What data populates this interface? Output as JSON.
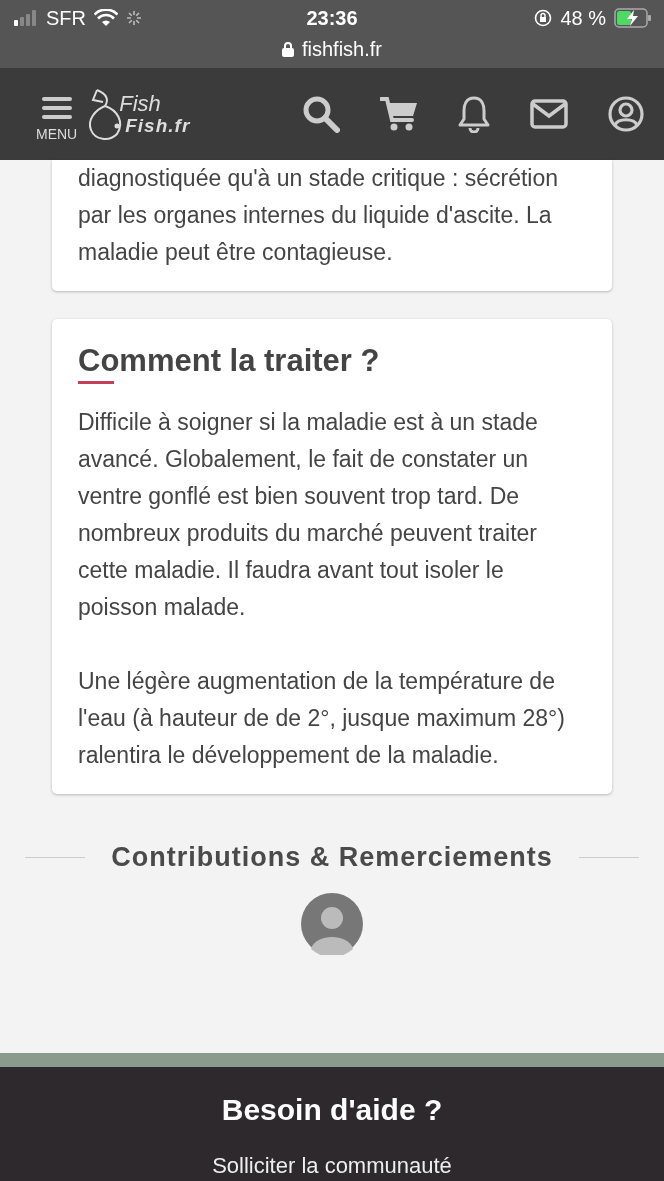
{
  "status_bar": {
    "carrier": "SFR",
    "time": "23:36",
    "battery": "48 %",
    "url": "fishfish.fr"
  },
  "header": {
    "menu_label": "MENU",
    "logo_lines": [
      "Fish",
      "Fish.fr"
    ]
  },
  "intro_card": {
    "paragraphs": [
      "diagnostiquée qu'à un stade critique : sécrétion par les organes internes du liquide d'ascite. La maladie peut être contagieuse."
    ]
  },
  "treatment_card": {
    "title": "Comment la traiter ?",
    "paragraphs": [
      "Difficile à soigner si la maladie est à un stade avancé. Globalement, le fait de constater un ventre gonflé est bien souvent trop tard. De nombreux produits du marché peuvent traiter cette maladie. Il faudra avant tout isoler le poisson malade.",
      "Une légère augmentation de la température de l'eau (à hauteur de de 2°, jusque maximum 28°) ralentira le développement de la maladie."
    ]
  },
  "contributions": {
    "title": "Contributions & Remerciements"
  },
  "footer": {
    "title": "Besoin d'aide ?",
    "link": "Solliciter la communauté"
  }
}
